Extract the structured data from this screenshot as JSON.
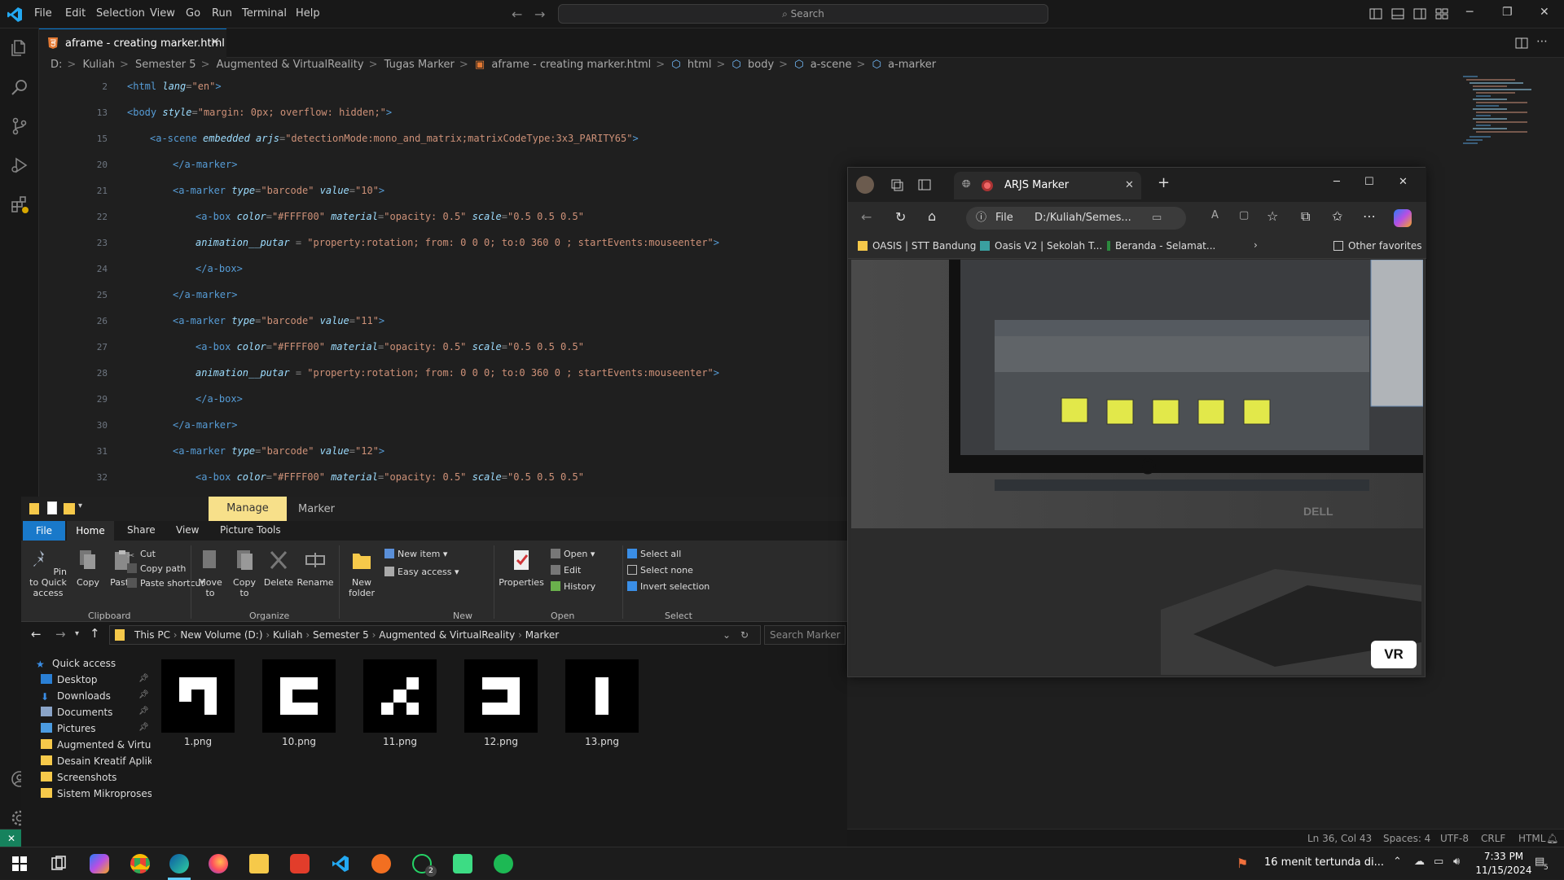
{
  "vscode": {
    "menu": [
      "File",
      "Edit",
      "Selection",
      "View",
      "Go",
      "Run",
      "Terminal",
      "Help"
    ],
    "search_placeholder": "Search",
    "tab": {
      "label": "aframe - creating marker.html"
    },
    "breadcrumb": [
      "D:",
      "Kuliah",
      "Semester 5",
      "Augmented & VirtualReality",
      "Tugas Marker",
      "aframe - creating marker.html",
      "html",
      "body",
      "a-scene",
      "a-marker"
    ],
    "code_lines": [
      {
        "ln": "2",
        "indent": 0,
        "parts": [
          [
            "t",
            "<html"
          ],
          [
            "a",
            " lang"
          ],
          [
            "p",
            "="
          ],
          [
            "s",
            "\"en\""
          ],
          [
            "t",
            ">"
          ]
        ]
      },
      {
        "ln": "13",
        "indent": 0,
        "parts": [
          [
            "t",
            "<body"
          ],
          [
            "a",
            " style"
          ],
          [
            "p",
            "="
          ],
          [
            "s",
            "\"margin: 0px; overflow: hidden;\""
          ],
          [
            "t",
            ">"
          ]
        ]
      },
      {
        "ln": "15",
        "indent": 1,
        "parts": [
          [
            "t",
            "<a-scene"
          ],
          [
            "a",
            " embedded arjs"
          ],
          [
            "p",
            "="
          ],
          [
            "s",
            "\"detectionMode:mono_and_matrix;matrixCodeType:3x3_PARITY65\""
          ],
          [
            "t",
            ">"
          ]
        ]
      },
      {
        "ln": "20",
        "indent": 2,
        "parts": [
          [
            "t",
            "</a-marker>"
          ]
        ]
      },
      {
        "ln": "21",
        "indent": 2,
        "parts": [
          [
            "t",
            "<a-marker"
          ],
          [
            "a",
            " type"
          ],
          [
            "p",
            "="
          ],
          [
            "s",
            "\"barcode\""
          ],
          [
            "a",
            " value"
          ],
          [
            "p",
            "="
          ],
          [
            "s",
            "\"10\""
          ],
          [
            "t",
            ">"
          ]
        ]
      },
      {
        "ln": "22",
        "indent": 3,
        "parts": [
          [
            "t",
            "<a-box"
          ],
          [
            "a",
            " color"
          ],
          [
            "p",
            "="
          ],
          [
            "s",
            "\"#FFFF00\""
          ],
          [
            "a",
            " material"
          ],
          [
            "p",
            "="
          ],
          [
            "s",
            "\"opacity: 0.5\""
          ],
          [
            "a",
            " scale"
          ],
          [
            "p",
            "="
          ],
          [
            "s",
            "\"0.5 0.5 0.5\""
          ]
        ]
      },
      {
        "ln": "23",
        "indent": 3,
        "parts": [
          [
            "a",
            "animation__putar"
          ],
          [
            "p",
            " = "
          ],
          [
            "s",
            "\"property:rotation; from: 0 0 0; to:0 360 0 ; startEvents:mouseenter\""
          ],
          [
            "t",
            ">"
          ]
        ]
      },
      {
        "ln": "24",
        "indent": 3,
        "parts": [
          [
            "t",
            "</a-box>"
          ]
        ]
      },
      {
        "ln": "25",
        "indent": 2,
        "parts": [
          [
            "t",
            "</a-marker>"
          ]
        ]
      },
      {
        "ln": "26",
        "indent": 2,
        "parts": [
          [
            "t",
            "<a-marker"
          ],
          [
            "a",
            " type"
          ],
          [
            "p",
            "="
          ],
          [
            "s",
            "\"barcode\""
          ],
          [
            "a",
            " value"
          ],
          [
            "p",
            "="
          ],
          [
            "s",
            "\"11\""
          ],
          [
            "t",
            ">"
          ]
        ]
      },
      {
        "ln": "27",
        "indent": 3,
        "parts": [
          [
            "t",
            "<a-box"
          ],
          [
            "a",
            " color"
          ],
          [
            "p",
            "="
          ],
          [
            "s",
            "\"#FFFF00\""
          ],
          [
            "a",
            " material"
          ],
          [
            "p",
            "="
          ],
          [
            "s",
            "\"opacity: 0.5\""
          ],
          [
            "a",
            " scale"
          ],
          [
            "p",
            "="
          ],
          [
            "s",
            "\"0.5 0.5 0.5\""
          ]
        ]
      },
      {
        "ln": "28",
        "indent": 3,
        "parts": [
          [
            "a",
            "animation__putar"
          ],
          [
            "p",
            " = "
          ],
          [
            "s",
            "\"property:rotation; from: 0 0 0; to:0 360 0 ; startEvents:mouseenter\""
          ],
          [
            "t",
            ">"
          ]
        ]
      },
      {
        "ln": "29",
        "indent": 3,
        "parts": [
          [
            "t",
            "</a-box>"
          ]
        ]
      },
      {
        "ln": "30",
        "indent": 2,
        "parts": [
          [
            "t",
            "</a-marker>"
          ]
        ]
      },
      {
        "ln": "31",
        "indent": 2,
        "parts": [
          [
            "t",
            "<a-marker"
          ],
          [
            "a",
            " type"
          ],
          [
            "p",
            "="
          ],
          [
            "s",
            "\"barcode\""
          ],
          [
            "a",
            " value"
          ],
          [
            "p",
            "="
          ],
          [
            "s",
            "\"12\""
          ],
          [
            "t",
            ">"
          ]
        ]
      },
      {
        "ln": "32",
        "indent": 3,
        "parts": [
          [
            "t",
            "<a-box"
          ],
          [
            "a",
            " color"
          ],
          [
            "p",
            "="
          ],
          [
            "s",
            "\"#FFFF00\""
          ],
          [
            "a",
            " material"
          ],
          [
            "p",
            "="
          ],
          [
            "s",
            "\"opacity: 0.5\""
          ],
          [
            "a",
            " scale"
          ],
          [
            "p",
            "="
          ],
          [
            "s",
            "\"0.5 0.5 0.5\""
          ]
        ]
      }
    ],
    "status": {
      "position": "Ln 36, Col 43",
      "spaces": "Spaces: 4",
      "encoding": "UTF-8",
      "eol": "CRLF",
      "language": "HTML"
    }
  },
  "explorer": {
    "manage_label": "Manage",
    "title": "Marker",
    "tabs": {
      "file": "File",
      "home": "Home",
      "share": "Share",
      "view": "View",
      "picture_tools": "Picture Tools"
    },
    "ribbon": {
      "pin": "Pin to Quick access",
      "copy": "Copy",
      "paste": "Paste",
      "cut": "Cut",
      "copy_path": "Copy path",
      "paste_shortcut": "Paste shortcut",
      "move_to": "Move to",
      "copy_to": "Copy to",
      "delete": "Delete",
      "rename": "Rename",
      "new_folder": "New folder",
      "new_item": "New item",
      "easy_access": "Easy access",
      "properties": "Properties",
      "open": "Open",
      "edit": "Edit",
      "history": "History",
      "select_all": "Select all",
      "select_none": "Select none",
      "invert_selection": "Invert selection",
      "groups": {
        "clipboard": "Clipboard",
        "organize": "Organize",
        "new": "New",
        "open": "Open",
        "select": "Select"
      }
    },
    "address": [
      "This PC",
      "New Volume (D:)",
      "Kuliah",
      "Semester 5",
      "Augmented & VirtualReality",
      "Marker"
    ],
    "search_placeholder": "Search Marker",
    "nav": {
      "quick_access": "Quick access",
      "items": [
        "Desktop",
        "Downloads",
        "Documents",
        "Pictures",
        "Augmented & Virtu",
        "Desain Kreatif Aplik",
        "Screenshots",
        "Sistem Mikroproses"
      ]
    },
    "files": [
      "1.png",
      "10.png",
      "11.png",
      "12.png",
      "13.png"
    ]
  },
  "browser": {
    "tab_title": "ARJS Marker",
    "url_scheme": "File",
    "url": "D:/Kuliah/Semes...",
    "favorites": [
      "OASIS | STT Bandung",
      "Oasis V2 | Sekolah T...",
      "Beranda - Selamat..."
    ],
    "other_favorites": "Other favorites",
    "vr_label": "VR",
    "camera_text": "DELL"
  },
  "taskbar": {
    "notification": "16 menit tertunda di...",
    "time": "7:33 PM",
    "date": "11/15/2024",
    "whatsapp_badge": "2",
    "notif_count": "5"
  }
}
